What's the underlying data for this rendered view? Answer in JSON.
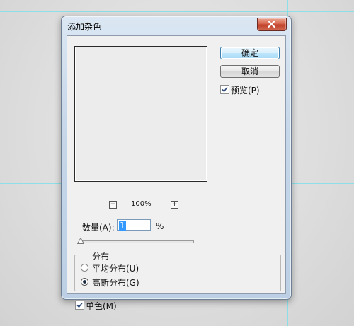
{
  "dialog": {
    "title": "添加杂色",
    "ok_label": "确定",
    "cancel_label": "取消",
    "preview_label": "预览(P)",
    "preview_checked": true
  },
  "preview_panel": {
    "zoom_level": "100%",
    "zoom_out_symbol": "−",
    "zoom_in_symbol": "+"
  },
  "amount": {
    "label": "数量(A):",
    "value": "1",
    "unit": "%",
    "slider_fraction": 0.01
  },
  "distribution": {
    "group_label": "分布",
    "options": [
      {
        "label": "平均分布(U)",
        "selected": false
      },
      {
        "label": "高斯分布(G)",
        "selected": true
      }
    ]
  },
  "monochromatic": {
    "label": "单色(M)",
    "checked": true
  },
  "icons": [
    "close-icon",
    "checkmark-icon",
    "radio-dot-icon",
    "slider-thumb-icon"
  ]
}
